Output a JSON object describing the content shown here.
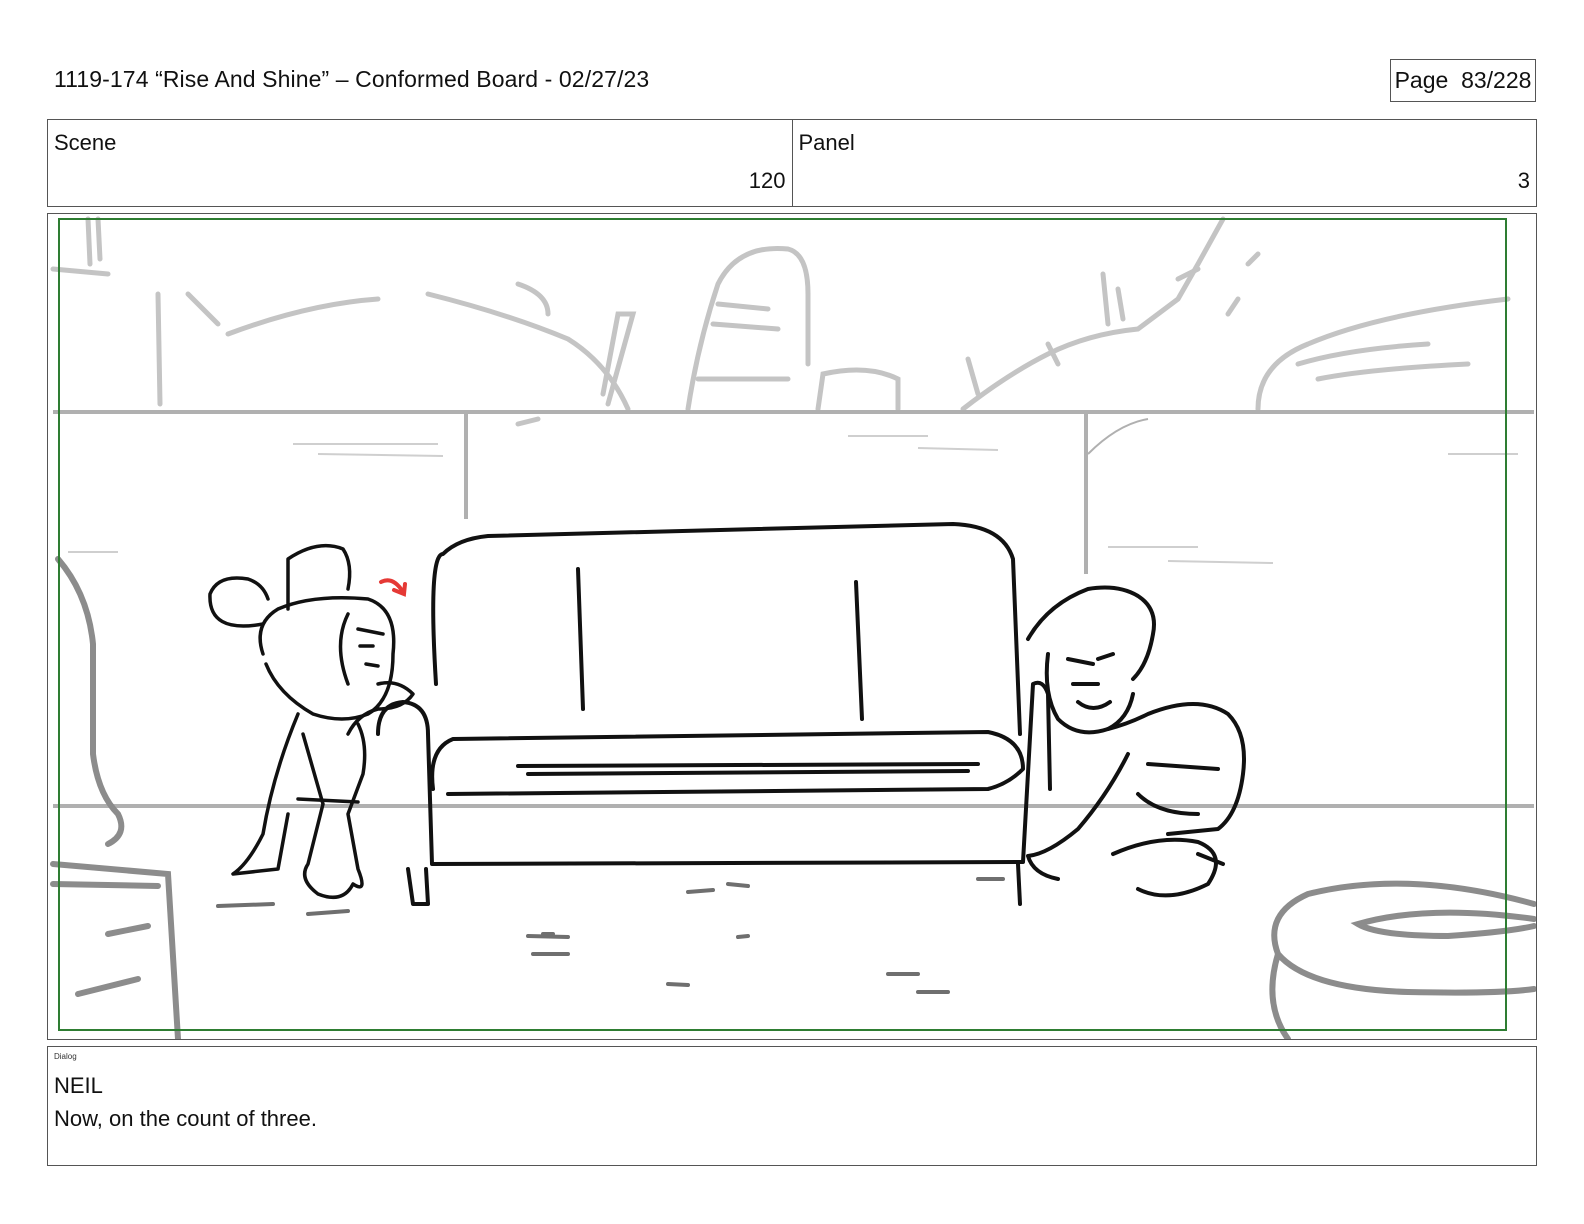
{
  "header": {
    "title": "1119-174 “Rise And Shine” – Conformed Board - 02/27/23",
    "page": "Page  83/228"
  },
  "info": {
    "scene_label": "Scene",
    "scene_value": "120",
    "panel_label": "Panel",
    "panel_value": "3"
  },
  "dialog": {
    "label": "Dialog",
    "speaker": "NEIL",
    "line": "Now, on the count of three."
  },
  "colors": {
    "safe_frame": "#2e7d32",
    "accent_arrow": "#e53935",
    "background_lines": "#bdbdbd"
  }
}
